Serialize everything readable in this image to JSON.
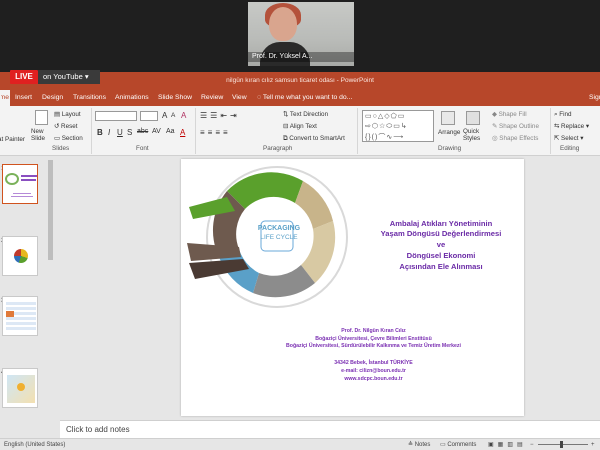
{
  "video": {
    "presenter_name": "Prof. Dr. Yüksel A...",
    "live_badge": "LIVE",
    "stream_target": "on YouTube"
  },
  "window": {
    "title": "nilgün kıran cılız samsun ticaret odası - PowerPoint"
  },
  "menu": {
    "items": [
      "Home",
      "Insert",
      "Design",
      "Transitions",
      "Animations",
      "Slide Show",
      "Review",
      "View"
    ],
    "tell_me": "Tell me what you want to do...",
    "sign_in": "Sign in"
  },
  "ribbon": {
    "format_painter": "Format Painter",
    "new_slide": "New Slide",
    "layout": "Layout",
    "reset": "Reset",
    "section": "Section",
    "text_direction": "Text Direction",
    "align_text": "Align Text",
    "convert_smartart": "Convert to SmartArt",
    "arrange": "Arrange",
    "quick_styles": "Quick Styles",
    "shape_fill": "Shape Fill",
    "shape_outline": "Shape Outline",
    "shape_effects": "Shape Effects",
    "find": "Find",
    "replace": "Replace",
    "select": "Select",
    "groups": {
      "slides": "Slides",
      "font": "Font",
      "paragraph": "Paragraph",
      "drawing": "Drawing",
      "editing": "Editing"
    }
  },
  "thumbnails": {
    "numbers": [
      "1",
      "2",
      "3",
      "4"
    ]
  },
  "slide": {
    "cycle_title_top": "PACKAGING",
    "cycle_title_bottom": "LIFE CYCLE",
    "title_lines": [
      "Ambalaj Atıkları Yönetiminin",
      "Yaşam Döngüsü Değerlendirmesi",
      "ve",
      "Döngüsel Ekonomi",
      "Açısından Ele Alınması"
    ],
    "author": "Prof. Dr. Nilgün Kıran Cılız",
    "affil_1": "Boğaziçi Üniversitesi, Çevre Bilimleri Enstitüsü",
    "affil_2": "Boğaziçi Üniversitesi, Sürdürülebilir Kalkınma ve Temiz Üretim Merkezi",
    "address": "34342 Bebek, İstanbul  TÜRKİYE",
    "email": "e-mail: ciliz​n@boun.edu.tr",
    "website": "www.sdcpc.boun.edu.tr"
  },
  "notes": {
    "placeholder": "Click to add notes"
  },
  "status": {
    "language": "English (United States)",
    "notes": "Notes",
    "comments": "Comments"
  },
  "colors": {
    "ppt_accent": "#b7472a",
    "title_purple": "#6a2aa6",
    "live_red": "#e02020",
    "cycle_green": "#5aa02c",
    "cycle_blue": "#5aa0c8",
    "cycle_tan": "#c8b48a",
    "cycle_brown": "#6e5a4e"
  }
}
